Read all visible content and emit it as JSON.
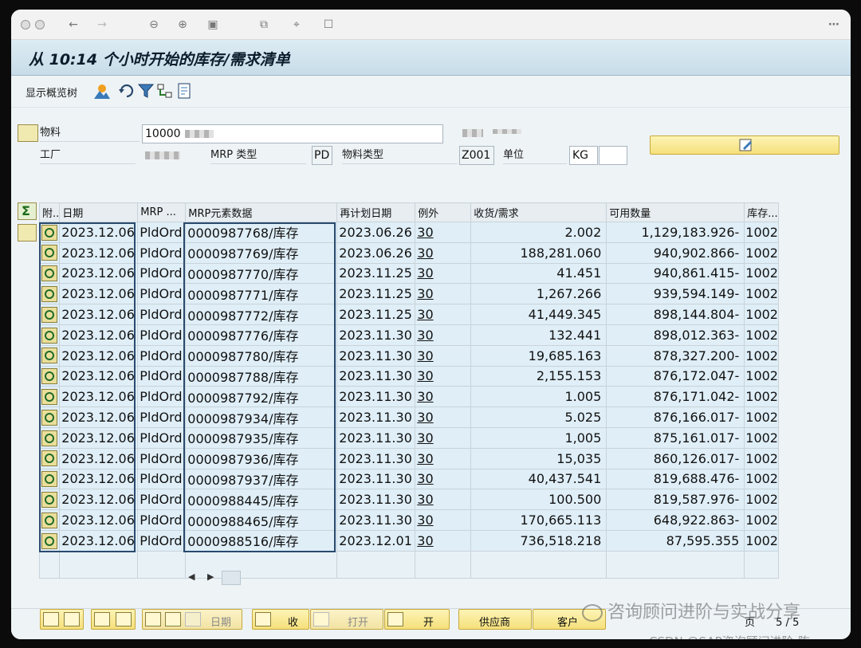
{
  "header": {
    "title": "从 10:14 个小时开始的库存/需求清单"
  },
  "appbar": {
    "show_tree_label": "显示概览树"
  },
  "fields": {
    "material_label": "物料",
    "material_value": "10000",
    "plant_label": "工厂",
    "mrp_type_label": "MRP 类型",
    "mrp_type_value": "PD",
    "material_type_label": "物料类型",
    "material_type_value": "Z001",
    "unit_label": "单位",
    "unit_value": "KG"
  },
  "table": {
    "columns": [
      "附..",
      "日期",
      "MRP ...",
      "MRP元素数据",
      "再计划日期",
      "例外",
      "收货/需求",
      "可用数量",
      "库存..."
    ],
    "rows": [
      {
        "date": "2023.12.06",
        "mrp": "PldOrd",
        "elem": "0000987768/库存",
        "resch": "2023.06.26",
        "exc": "30",
        "qty": "2.002",
        "avail": "1,129,183.926-",
        "stor": "1002"
      },
      {
        "date": "2023.12.06",
        "mrp": "PldOrd",
        "elem": "0000987769/库存",
        "resch": "2023.06.26",
        "exc": "30",
        "qty": "188,281.060",
        "avail": "940,902.866-",
        "stor": "1002"
      },
      {
        "date": "2023.12.06",
        "mrp": "PldOrd",
        "elem": "0000987770/库存",
        "resch": "2023.11.25",
        "exc": "30",
        "qty": "41.451",
        "avail": "940,861.415-",
        "stor": "1002"
      },
      {
        "date": "2023.12.06",
        "mrp": "PldOrd",
        "elem": "0000987771/库存",
        "resch": "2023.11.25",
        "exc": "30",
        "qty": "1,267.266",
        "avail": "939,594.149-",
        "stor": "1002"
      },
      {
        "date": "2023.12.06",
        "mrp": "PldOrd",
        "elem": "0000987772/库存",
        "resch": "2023.11.25",
        "exc": "30",
        "qty": "41,449.345",
        "avail": "898,144.804-",
        "stor": "1002"
      },
      {
        "date": "2023.12.06",
        "mrp": "PldOrd",
        "elem": "0000987776/库存",
        "resch": "2023.11.30",
        "exc": "30",
        "qty": "132.441",
        "avail": "898,012.363-",
        "stor": "1002"
      },
      {
        "date": "2023.12.06",
        "mrp": "PldOrd",
        "elem": "0000987780/库存",
        "resch": "2023.11.30",
        "exc": "30",
        "qty": "19,685.163",
        "avail": "878,327.200-",
        "stor": "1002"
      },
      {
        "date": "2023.12.06",
        "mrp": "PldOrd",
        "elem": "0000987788/库存",
        "resch": "2023.11.30",
        "exc": "30",
        "qty": "2,155.153",
        "avail": "876,172.047-",
        "stor": "1002"
      },
      {
        "date": "2023.12.06",
        "mrp": "PldOrd",
        "elem": "0000987792/库存",
        "resch": "2023.11.30",
        "exc": "30",
        "qty": "1.005",
        "avail": "876,171.042-",
        "stor": "1002"
      },
      {
        "date": "2023.12.06",
        "mrp": "PldOrd",
        "elem": "0000987934/库存",
        "resch": "2023.11.30",
        "exc": "30",
        "qty": "5.025",
        "avail": "876,166.017-",
        "stor": "1002"
      },
      {
        "date": "2023.12.06",
        "mrp": "PldOrd",
        "elem": "0000987935/库存",
        "resch": "2023.11.30",
        "exc": "30",
        "qty": "1,005",
        "avail": "875,161.017-",
        "stor": "1002"
      },
      {
        "date": "2023.12.06",
        "mrp": "PldOrd",
        "elem": "0000987936/库存",
        "resch": "2023.11.30",
        "exc": "30",
        "qty": "15,035",
        "avail": "860,126.017-",
        "stor": "1002"
      },
      {
        "date": "2023.12.06",
        "mrp": "PldOrd",
        "elem": "0000987937/库存",
        "resch": "2023.11.30",
        "exc": "30",
        "qty": "40,437.541",
        "avail": "819,688.476-",
        "stor": "1002"
      },
      {
        "date": "2023.12.06",
        "mrp": "PldOrd",
        "elem": "0000988445/库存",
        "resch": "2023.11.30",
        "exc": "30",
        "qty": "100.500",
        "avail": "819,587.976-",
        "stor": "1002"
      },
      {
        "date": "2023.12.06",
        "mrp": "PldOrd",
        "elem": "0000988465/库存",
        "resch": "2023.11.30",
        "exc": "30",
        "qty": "170,665.113",
        "avail": "648,922.863-",
        "stor": "1002"
      },
      {
        "date": "2023.12.06",
        "mrp": "PldOrd",
        "elem": "0000988516/库存",
        "resch": "2023.12.01",
        "exc": "30",
        "qty": "736,518.218",
        "avail": "87,595.355",
        "stor": "1002"
      }
    ]
  },
  "bottom": {
    "date_label": "日期",
    "receipt_label": "收",
    "open_label": "打开",
    "open2_label": "开",
    "vendor_label": "供应商",
    "customer_label": "客户",
    "page_label": "页",
    "page_value": "5 / 5"
  },
  "watermark": {
    "line1": "咨询顾问进阶与实战分享",
    "line2": "CSDN @SAP咨询顾问进阶-陈"
  }
}
